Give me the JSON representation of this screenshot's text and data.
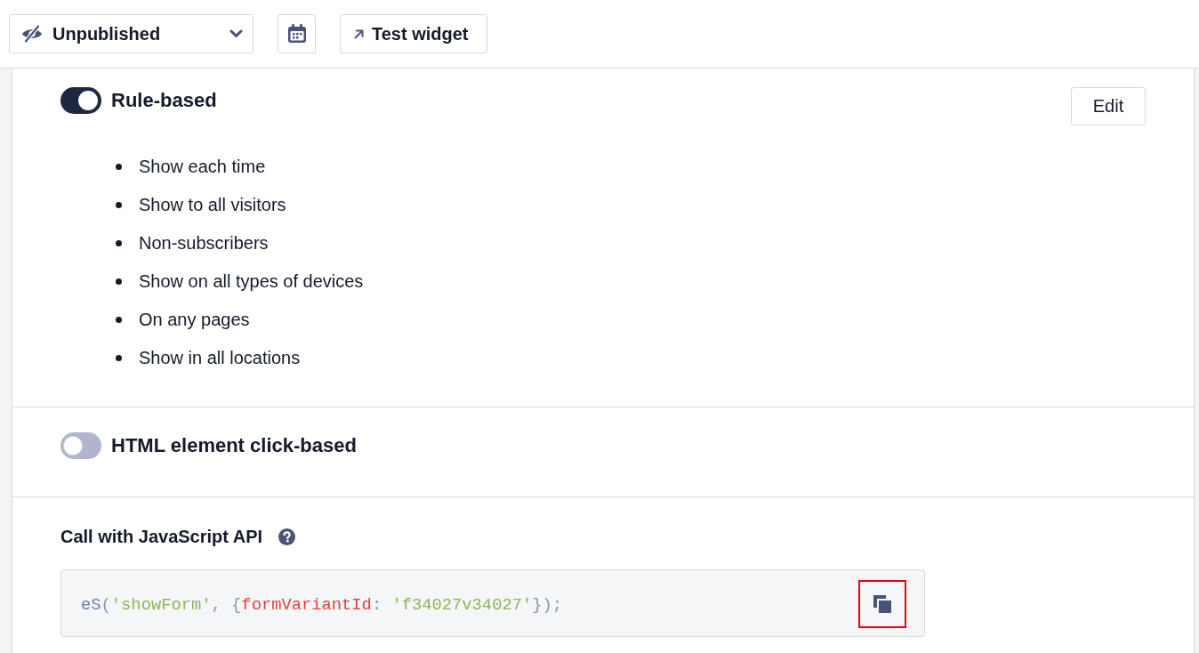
{
  "toolbar": {
    "status_select": {
      "value": "Unpublished"
    },
    "test_button": {
      "label": "Test widget"
    }
  },
  "sections": [
    {
      "kind": "toggle",
      "title": "Rule-based",
      "on": true,
      "edit_button": {
        "label": "Edit"
      },
      "rules": [
        "Show each time",
        "Show to all visitors",
        "Non-subscribers",
        "Show on all types of devices",
        "On any pages",
        "Show in all locations"
      ]
    },
    {
      "kind": "toggle",
      "title": "HTML element click-based",
      "on": false
    },
    {
      "kind": "api",
      "title": "Call with JavaScript API",
      "code": [
        {
          "kind": "func",
          "text": "eS"
        },
        {
          "kind": "punct",
          "text": "("
        },
        {
          "kind": "string",
          "text": "'showForm'"
        },
        {
          "kind": "punct",
          "text": ", {"
        },
        {
          "kind": "key",
          "text": "formVariantId"
        },
        {
          "kind": "punct",
          "text": ": "
        },
        {
          "kind": "string",
          "text": "'f34027v34027'"
        },
        {
          "kind": "punct",
          "text": "});"
        }
      ],
      "copy_button": {
        "highlighted": true
      }
    }
  ]
}
